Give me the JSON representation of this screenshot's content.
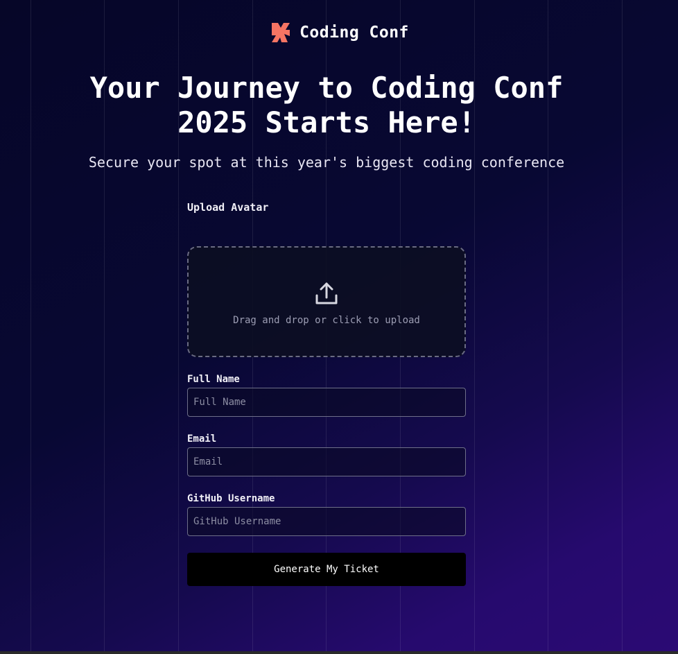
{
  "brand": {
    "name": "Coding Conf",
    "logo_icon": "coding-conf-logo-icon",
    "accent_color": "#f57463"
  },
  "hero": {
    "title": "Your Journey to Coding Conf 2025 Starts Here!",
    "subtitle": "Secure your spot at this year's biggest coding conference"
  },
  "form": {
    "upload_label": "Upload Avatar",
    "upload_hint": "Drag and drop or click to upload",
    "upload_icon": "upload-icon",
    "full_name": {
      "label": "Full Name",
      "placeholder": "Full Name",
      "value": ""
    },
    "email": {
      "label": "Email",
      "placeholder": "Email",
      "value": ""
    },
    "github": {
      "label": "GitHub Username",
      "placeholder": "GitHub Username",
      "value": ""
    },
    "submit_label": "Generate My Ticket"
  }
}
